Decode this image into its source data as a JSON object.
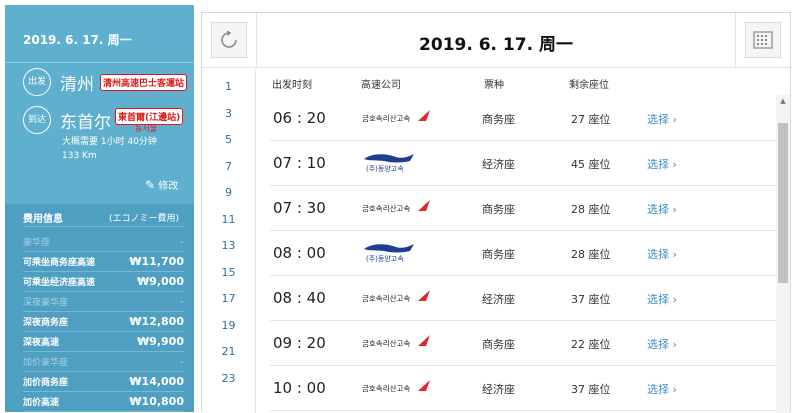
{
  "sidebar": {
    "date": "2019. 6. 17. 周一",
    "departure": {
      "badge": "出发",
      "city": "清州",
      "tag": "清州高速巴士客運站"
    },
    "arrival": {
      "badge": "到达",
      "city": "东首尔",
      "tag": "東首爾(江邊站)",
      "tag_ko": "동서울"
    },
    "duration": "大概需要 1小时 40分钟",
    "distance": "133 Km",
    "edit_label": "修改",
    "fee": {
      "title": "费用信息",
      "subtitle": "(エコノミー費用)",
      "rows": [
        {
          "type": "cat",
          "label": "豪华座",
          "amount": "-"
        },
        {
          "type": "item",
          "label": "可乘坐商务座高速",
          "amount": "₩11,700"
        },
        {
          "type": "item",
          "label": "可乘坐经济座高速",
          "amount": "₩9,000"
        },
        {
          "type": "cat",
          "label": "深夜豪华座",
          "amount": "-"
        },
        {
          "type": "item",
          "label": "深夜商务座",
          "amount": "₩12,800"
        },
        {
          "type": "item",
          "label": "深夜高速",
          "amount": "₩9,900"
        },
        {
          "type": "cat",
          "label": "加价豪华座",
          "amount": "-"
        },
        {
          "type": "item",
          "label": "加价商务座",
          "amount": "₩14,000"
        },
        {
          "type": "item",
          "label": "加价高速",
          "amount": "₩10,800"
        }
      ]
    }
  },
  "main": {
    "title": "2019. 6. 17. 周一",
    "hours": [
      "1",
      "3",
      "5",
      "7",
      "9",
      "11",
      "13",
      "15",
      "17",
      "19",
      "21",
      "23"
    ],
    "columns": {
      "time": "出发时刻",
      "company": "高速公司",
      "ticket": "票种",
      "seats": "剩余座位"
    },
    "rows": [
      {
        "time": "06 : 20",
        "company": "kumho-logo",
        "ticket": "商务座",
        "seats": "27 座位",
        "action": "选择 ›"
      },
      {
        "time": "07 : 10",
        "company": "dongyang-logo",
        "ticket": "经济座",
        "seats": "45 座位",
        "action": "选择 ›"
      },
      {
        "time": "07 : 30",
        "company": "kumho-logo",
        "ticket": "商务座",
        "seats": "28 座位",
        "action": "选择 ›"
      },
      {
        "time": "08 : 00",
        "company": "dongyang-logo",
        "ticket": "商务座",
        "seats": "28 座位",
        "action": "选择 ›"
      },
      {
        "time": "08 : 40",
        "company": "kumho-logo",
        "ticket": "经济座",
        "seats": "37 座位",
        "action": "选择 ›"
      },
      {
        "time": "09 : 20",
        "company": "kumho-logo",
        "ticket": "商务座",
        "seats": "22 座位",
        "action": "选择 ›"
      },
      {
        "time": "10 : 00",
        "company": "kumho-logo",
        "ticket": "经济座",
        "seats": "37 座位",
        "action": "选择 ›"
      }
    ],
    "logos": {
      "kumho": "금호속리산고속",
      "dongyang": "(주)동양고속"
    }
  },
  "colors": {
    "sidebar": "#5fb0cf",
    "fee_panel": "#4e9fc2",
    "accent": "#3a8fc4",
    "tag": "#e01818"
  }
}
